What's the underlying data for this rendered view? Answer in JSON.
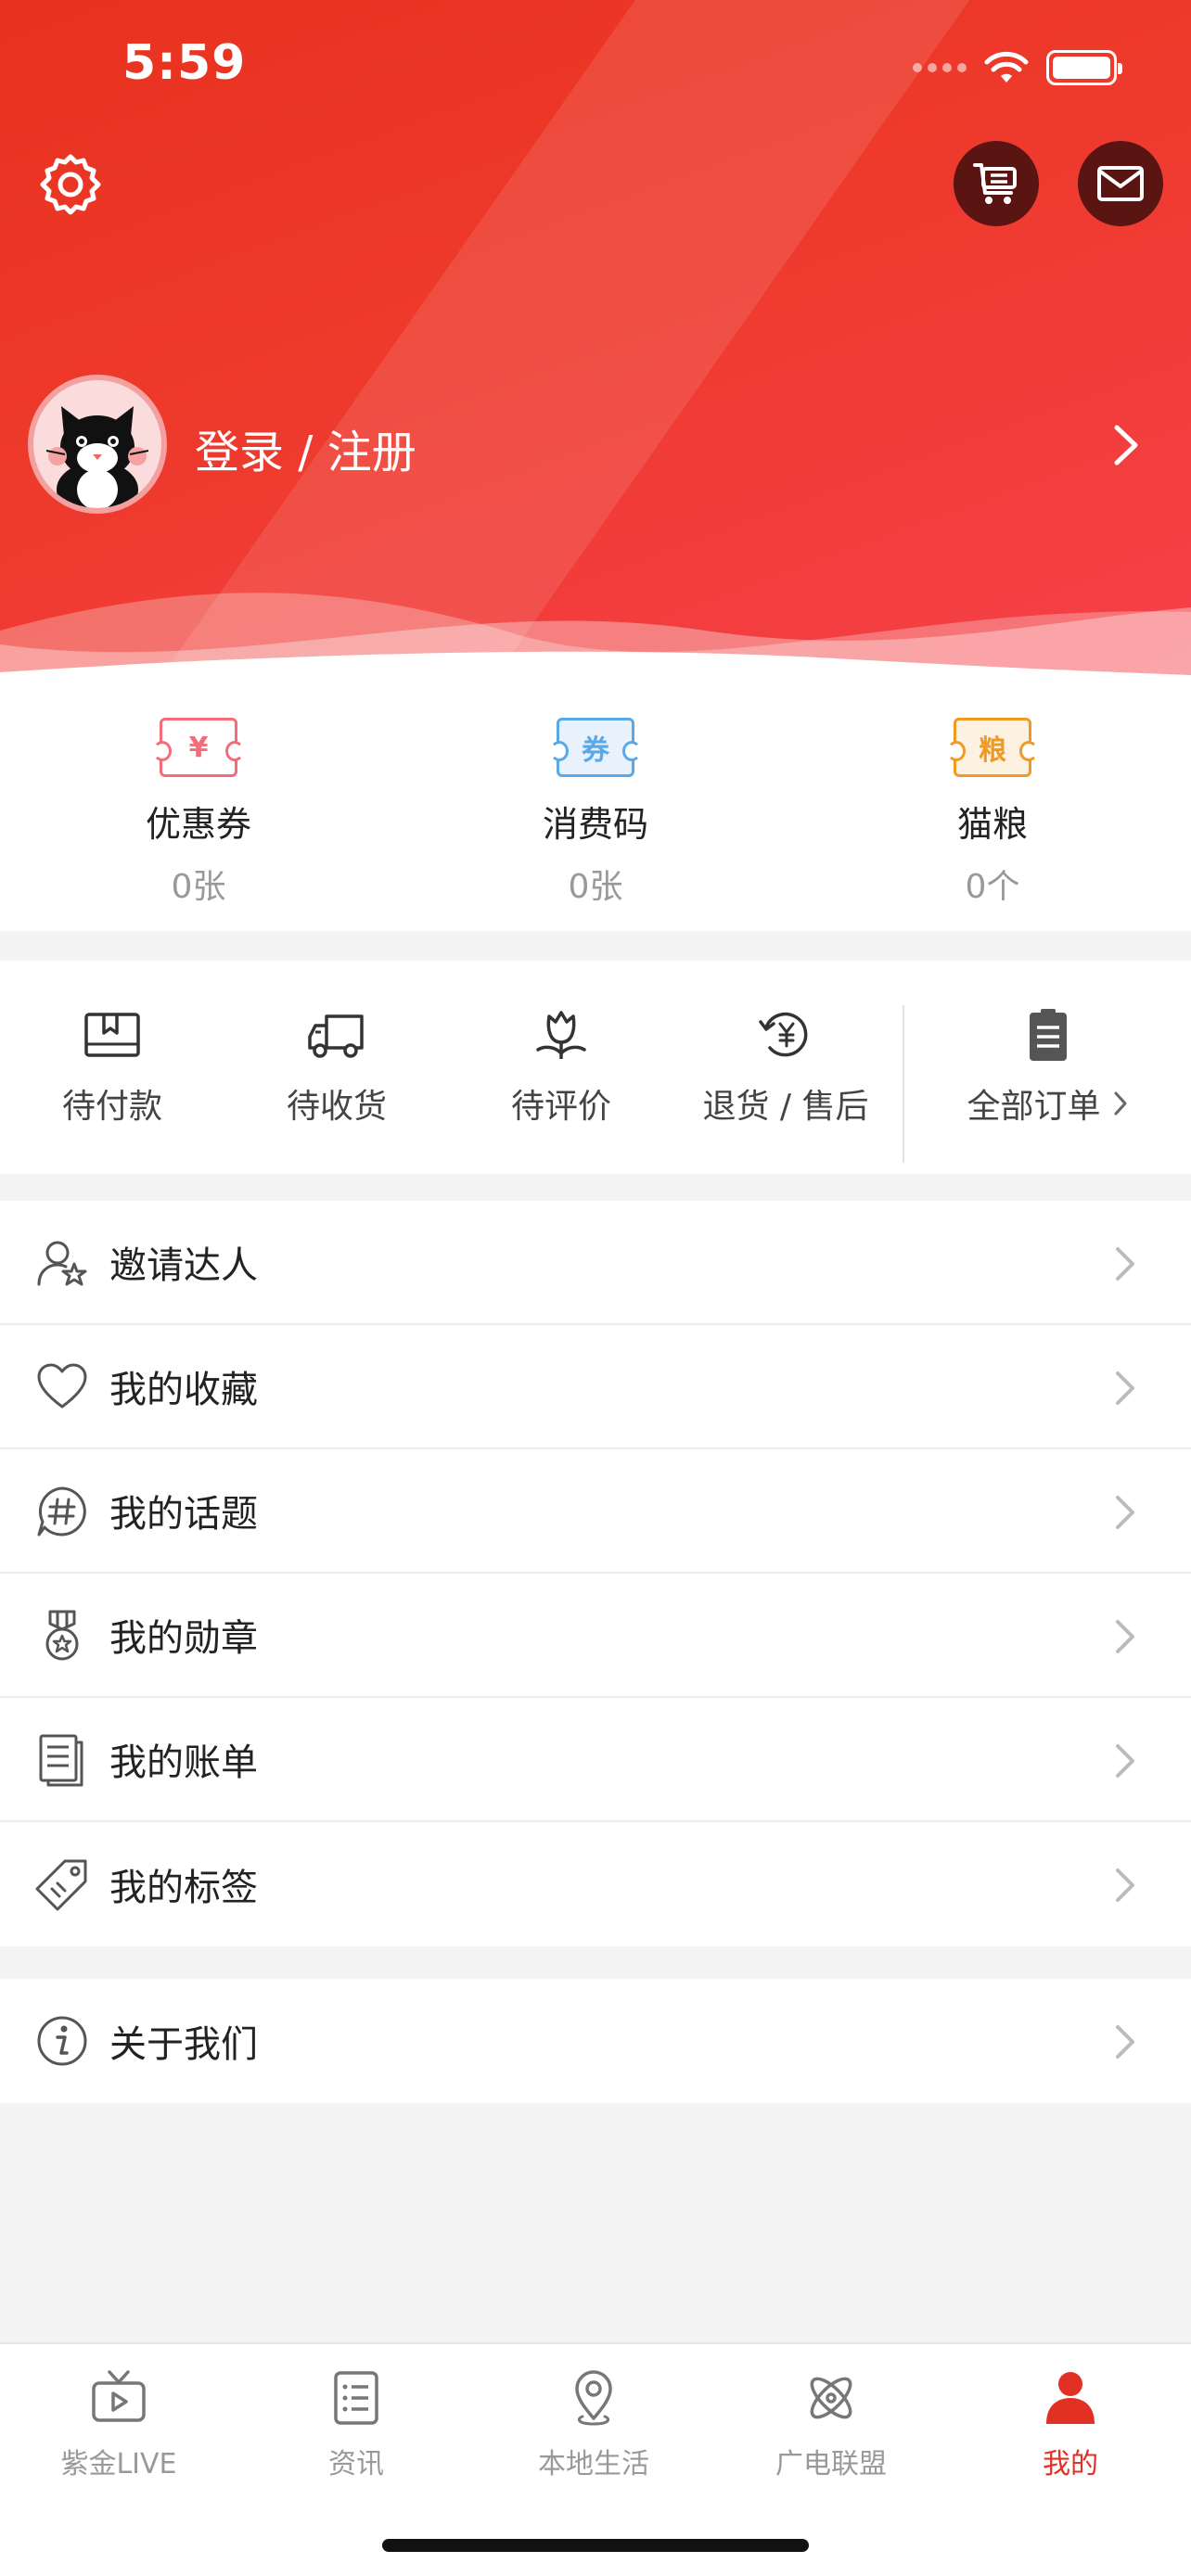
{
  "status_bar": {
    "time": "5:59"
  },
  "header": {
    "login_text": "登录 / 注册"
  },
  "wallet": [
    {
      "glyph": "¥",
      "label": "优惠券",
      "count": "0张",
      "color": "#f46c7a"
    },
    {
      "glyph": "券",
      "label": "消费码",
      "count": "0张",
      "color": "#5aa8e6"
    },
    {
      "glyph": "粮",
      "label": "猫粮",
      "count": "0个",
      "color": "#ef9a25"
    }
  ],
  "orders": {
    "items": [
      {
        "label": "待付款",
        "icon": "wallet-icon"
      },
      {
        "label": "待收货",
        "icon": "truck-icon"
      },
      {
        "label": "待评价",
        "icon": "flower-icon"
      },
      {
        "label": "退货 / 售后",
        "icon": "refund-icon"
      }
    ],
    "all_label": "全部订单"
  },
  "menu_main": [
    {
      "label": "邀请达人",
      "icon": "invite-user-icon"
    },
    {
      "label": "我的收藏",
      "icon": "heart-icon"
    },
    {
      "label": "我的话题",
      "icon": "hashtag-icon"
    },
    {
      "label": "我的勋章",
      "icon": "medal-icon"
    },
    {
      "label": "我的账单",
      "icon": "bill-icon"
    },
    {
      "label": "我的标签",
      "icon": "tag-icon"
    }
  ],
  "menu_about": [
    {
      "label": "关于我们",
      "icon": "info-icon"
    }
  ],
  "tabbar": [
    {
      "label": "紫金LIVE",
      "icon": "tv-icon",
      "active": false
    },
    {
      "label": "资讯",
      "icon": "news-icon",
      "active": false
    },
    {
      "label": "本地生活",
      "icon": "location-icon",
      "active": false
    },
    {
      "label": "广电联盟",
      "icon": "atom-icon",
      "active": false
    },
    {
      "label": "我的",
      "icon": "user-icon",
      "active": true
    }
  ],
  "colors": {
    "brand_red": "#e8321f",
    "active_tab": "#e33025"
  }
}
